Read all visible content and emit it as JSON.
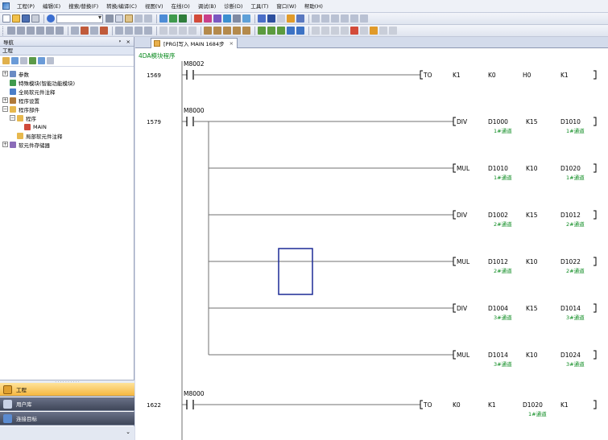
{
  "menubar": {
    "items": [
      "工程(P)",
      "编辑(E)",
      "搜索/替换(F)",
      "转换/编译(C)",
      "视图(V)",
      "在线(O)",
      "调试(B)",
      "诊断(D)",
      "工具(T)",
      "窗口(W)",
      "帮助(H)"
    ]
  },
  "navigation": {
    "title": "导航",
    "pin": "ᵖ",
    "close": "×",
    "project_label": "工程",
    "tree": [
      {
        "label": "参数",
        "level": 0,
        "toggle": "+",
        "icon": "param-icon"
      },
      {
        "label": "特殊模块(智能功能模块)",
        "level": 0,
        "toggle": "",
        "icon": "module-icon"
      },
      {
        "label": "全局软元件注释",
        "level": 0,
        "toggle": "",
        "icon": "comment-icon"
      },
      {
        "label": "程序设置",
        "level": 0,
        "toggle": "+",
        "icon": "settings-icon"
      },
      {
        "label": "程序部件",
        "level": 0,
        "toggle": "−",
        "icon": "folder-icon"
      },
      {
        "label": "程序",
        "level": 1,
        "toggle": "−",
        "icon": "folder-icon"
      },
      {
        "label": "MAIN",
        "level": 2,
        "toggle": "",
        "icon": "program-icon"
      },
      {
        "label": "局部软元件注释",
        "level": 1,
        "toggle": "",
        "icon": "folder-icon"
      },
      {
        "label": "软元件存储器",
        "level": 0,
        "toggle": "+",
        "icon": "memory-icon"
      }
    ],
    "tabs": {
      "project": "工程",
      "userlib": "用户库",
      "connect": "连接目标"
    },
    "bottom_chevron": "⌄"
  },
  "editor": {
    "tab_label": "[PRG]写入 MAIN 1684步",
    "tab_close": "×",
    "program_title": "4DA模块程序",
    "rungs": [
      {
        "step": "1569",
        "contact": "M8002",
        "instructions": [
          {
            "op": "TO",
            "args": [
              {
                "v": "K1"
              },
              {
                "v": "K0"
              },
              {
                "v": "H0"
              },
              {
                "v": "K1"
              }
            ]
          }
        ]
      },
      {
        "step": "1579",
        "contact": "M8000",
        "instructions": [
          {
            "op": "DIV",
            "args": [
              {
                "v": "D1000",
                "c": "1#通道"
              },
              {
                "v": "K15"
              },
              {
                "v": "D1010",
                "c": "1#通道"
              }
            ]
          },
          {
            "op": "MUL",
            "args": [
              {
                "v": "D1010",
                "c": "1#通道"
              },
              {
                "v": "K10"
              },
              {
                "v": "D1020",
                "c": "1#通道"
              }
            ]
          },
          {
            "op": "DIV",
            "args": [
              {
                "v": "D1002",
                "c": "2#通道"
              },
              {
                "v": "K15"
              },
              {
                "v": "D1012",
                "c": "2#通道"
              }
            ]
          },
          {
            "op": "MUL",
            "args": [
              {
                "v": "D1012",
                "c": "2#通道"
              },
              {
                "v": "K10"
              },
              {
                "v": "D1022",
                "c": "2#通道"
              }
            ]
          },
          {
            "op": "DIV",
            "args": [
              {
                "v": "D1004",
                "c": "3#通道"
              },
              {
                "v": "K15"
              },
              {
                "v": "D1014",
                "c": "3#通道"
              }
            ]
          },
          {
            "op": "MUL",
            "args": [
              {
                "v": "D1014",
                "c": "3#通道"
              },
              {
                "v": "K10"
              },
              {
                "v": "D1024",
                "c": "3#通道"
              }
            ]
          }
        ]
      },
      {
        "step": "1622",
        "contact": "M8000",
        "instructions": [
          {
            "op": "TO",
            "args": [
              {
                "v": "K0"
              },
              {
                "v": "K1"
              },
              {
                "v": "D1020",
                "c": "1#通道"
              },
              {
                "v": "K1"
              }
            ]
          }
        ]
      }
    ]
  },
  "colors": {
    "comment": "#0a8a1e",
    "wire": "#707070",
    "cursor": "#1c2a96",
    "active_tab": "#f5b63f"
  }
}
